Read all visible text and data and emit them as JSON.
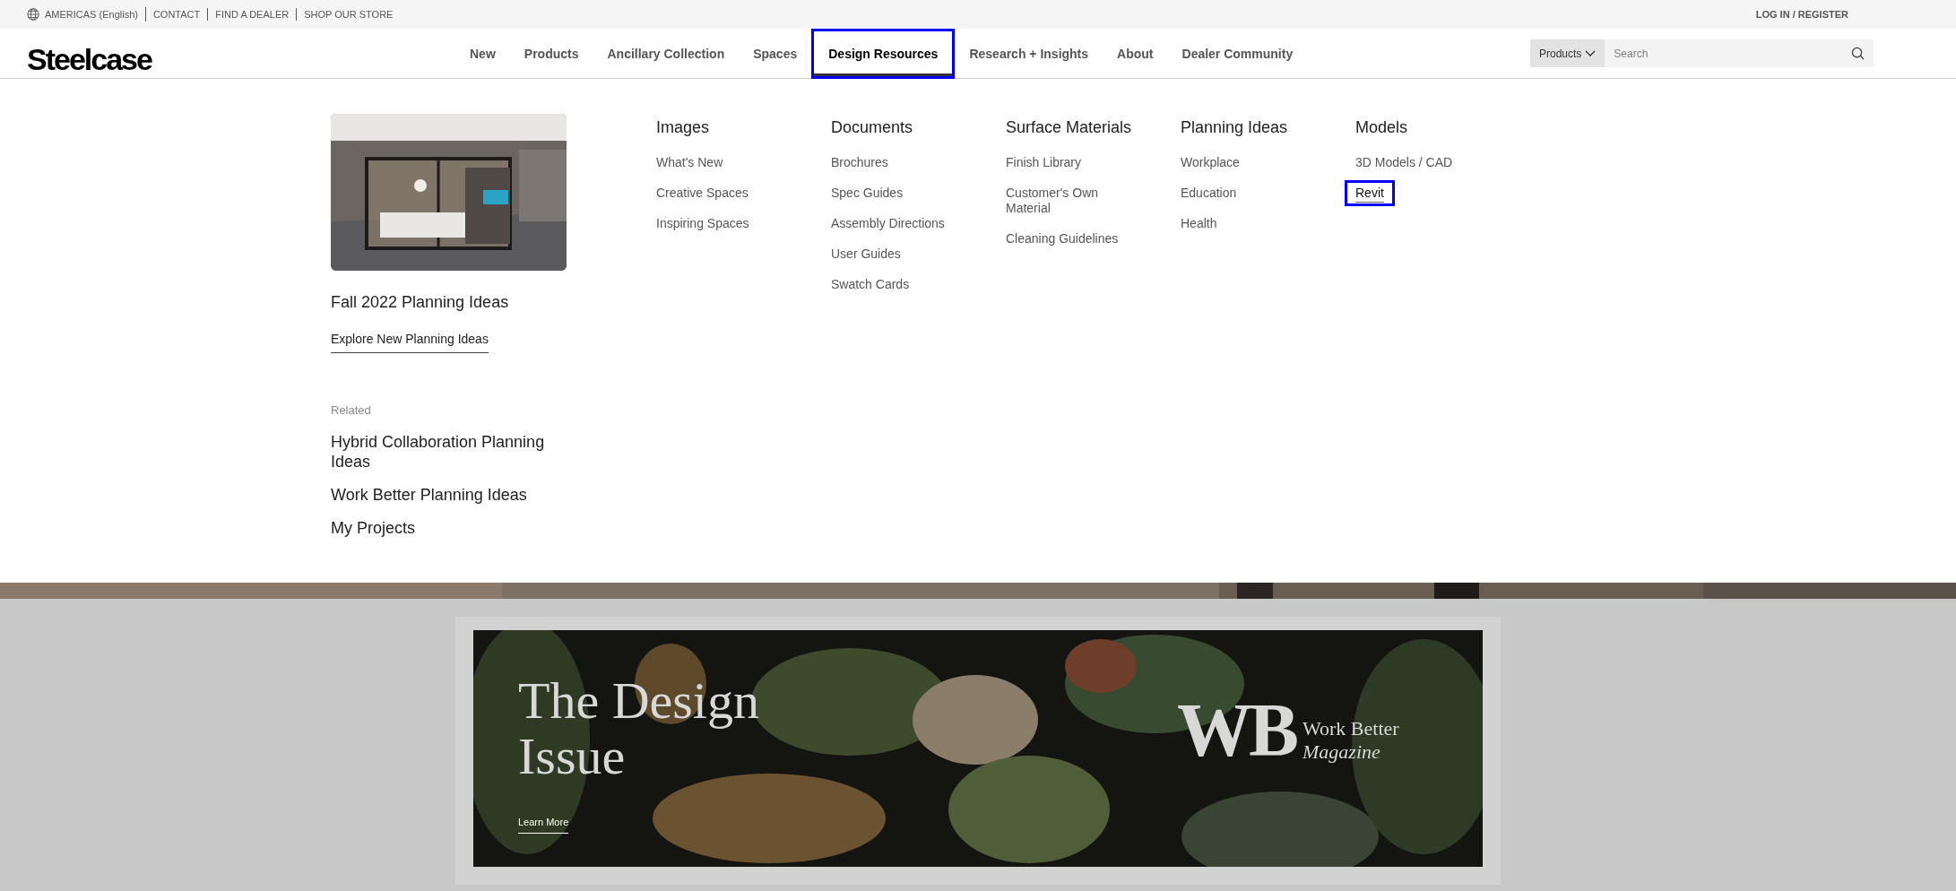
{
  "utility_bar": {
    "region": "AMERICAS (English)",
    "links": [
      "CONTACT",
      "FIND A DEALER",
      "SHOP OUR STORE"
    ],
    "account": "LOG IN / REGISTER"
  },
  "header": {
    "logo": "Steelcase",
    "nav": [
      {
        "label": "New",
        "selected": false
      },
      {
        "label": "Products",
        "selected": false
      },
      {
        "label": "Ancillary Collection",
        "selected": false
      },
      {
        "label": "Spaces",
        "selected": false
      },
      {
        "label": "Design Resources",
        "selected": true
      },
      {
        "label": "Research + Insights",
        "selected": false
      },
      {
        "label": "About",
        "selected": false
      },
      {
        "label": "Dealer Community",
        "selected": false
      }
    ],
    "search": {
      "scope": "Products",
      "placeholder": "Search"
    }
  },
  "mega_menu": {
    "feature": {
      "kind": "picture",
      "title": "Fall 2022 Planning Ideas",
      "link": "Explore New Planning Ideas"
    },
    "related": {
      "heading": "Related",
      "links": [
        "Hybrid Collaboration Planning Ideas",
        "Work Better Planning Ideas",
        "My Projects"
      ]
    },
    "columns": [
      {
        "heading": "Images",
        "links": [
          {
            "label": "What's New",
            "selected": false
          },
          {
            "label": "Creative Spaces",
            "selected": false
          },
          {
            "label": "Inspiring Spaces",
            "selected": false
          }
        ]
      },
      {
        "heading": "Documents",
        "links": [
          {
            "label": "Brochures",
            "selected": false
          },
          {
            "label": "Spec Guides",
            "selected": false
          },
          {
            "label": "Assembly Directions",
            "selected": false
          },
          {
            "label": "User Guides",
            "selected": false
          },
          {
            "label": "Swatch Cards",
            "selected": false
          }
        ]
      },
      {
        "heading": "Surface Materials",
        "links": [
          {
            "label": "Finish Library",
            "selected": false
          },
          {
            "label": "Customer's Own Material",
            "selected": false
          },
          {
            "label": "Cleaning Guidelines",
            "selected": false
          }
        ]
      },
      {
        "heading": "Planning Ideas",
        "links": [
          {
            "label": "Workplace",
            "selected": false
          },
          {
            "label": "Education",
            "selected": false
          },
          {
            "label": "Health",
            "selected": false
          }
        ]
      },
      {
        "heading": "Models",
        "links": [
          {
            "label": "3D Models / CAD",
            "selected": false
          },
          {
            "label": "Revit",
            "selected": true
          }
        ]
      }
    ]
  },
  "banner": {
    "title_lines": [
      "The Design",
      "Issue"
    ],
    "link": "Learn More",
    "monogram": "WB",
    "brand_lines": [
      "Work Better",
      "Magazine"
    ]
  }
}
